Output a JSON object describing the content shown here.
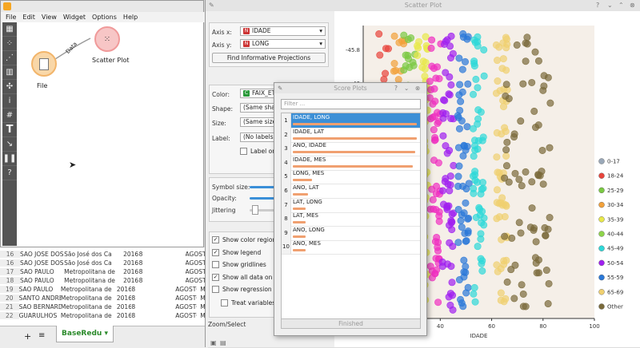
{
  "menu": [
    "File",
    "Edit",
    "View",
    "Widget",
    "Options",
    "Help"
  ],
  "workflow": {
    "file_label": "File",
    "scatter_label": "Scatter Plot",
    "link_label": "Data"
  },
  "sheet": {
    "rows": [
      [
        "16",
        "SAO JOSE DOS",
        "São José dos Ca",
        "2016",
        "8",
        "AGOSTO"
      ],
      [
        "16",
        "SAO JOSE DOS",
        "São José dos Ca",
        "2016",
        "8",
        "AGOSTO"
      ],
      [
        "17",
        "SAO PAULO",
        "Metropolitana de",
        "2016",
        "8",
        "AGOSTO"
      ],
      [
        "18",
        "SAO PAULO",
        "Metropolitana de",
        "2016",
        "8",
        "AGOSTO"
      ],
      [
        "19",
        "SAO PAULO",
        "Metropolitana de",
        "2016",
        "8",
        "AGOSTO"
      ],
      [
        "20",
        "SANTO ANDRE",
        "Metropolitana de",
        "2016",
        "8",
        "AGOSTO"
      ],
      [
        "21",
        "SAO BERNARD",
        "Metropolitana de",
        "2016",
        "8",
        "AGOSTO"
      ],
      [
        "22",
        "GUARULHOS",
        "Metropolitana de",
        "2016",
        "8",
        "AGOSTO"
      ]
    ],
    "extra_ma": "MA",
    "tab_label": "BaseRedu"
  },
  "scatter": {
    "title": "Scatter Plot",
    "axis_x_label": "Axis x:",
    "axis_x_value": "IDADE",
    "axis_y_label": "Axis y:",
    "axis_y_value": "LONG",
    "find_button": "Find Informative Projections",
    "color_label": "Color:",
    "color_value": "FAIX_ETAR",
    "shape_label": "Shape:",
    "shape_value": "(Same shape)",
    "size_label": "Size:",
    "size_value": "(Same size)",
    "label_label": "Label:",
    "label_value": "(No labels)",
    "label_only_selected": "Label only s",
    "symbol_size": "Symbol size:",
    "opacity": "Opacity:",
    "jittering": "Jittering",
    "checks": [
      {
        "label": "Show color regions",
        "checked": true
      },
      {
        "label": "Show legend",
        "checked": true
      },
      {
        "label": "Show gridlines",
        "checked": false
      },
      {
        "label": "Show all data on mou",
        "checked": true
      },
      {
        "label": "Show regression line",
        "checked": false
      }
    ],
    "treat_vars": "Treat variables as i",
    "zoom_select": "Zoom/Select"
  },
  "score": {
    "title": "Score Plots",
    "filter_placeholder": "Filter ...",
    "items": [
      {
        "n": "1",
        "label": "IDADE, LONG",
        "score": 0.98,
        "selected": true
      },
      {
        "n": "2",
        "label": "IDADE, LAT",
        "score": 0.98,
        "selected": false
      },
      {
        "n": "3",
        "label": "ANO, IDADE",
        "score": 0.97,
        "selected": false
      },
      {
        "n": "4",
        "label": "IDADE, MES",
        "score": 0.95,
        "selected": false
      },
      {
        "n": "5",
        "label": "LONG, MES",
        "score": 0.15,
        "selected": false
      },
      {
        "n": "6",
        "label": "ANO, LAT",
        "score": 0.12,
        "selected": false
      },
      {
        "n": "7",
        "label": "LAT, LONG",
        "score": 0.1,
        "selected": false
      },
      {
        "n": "8",
        "label": "LAT, MES",
        "score": 0.1,
        "selected": false
      },
      {
        "n": "9",
        "label": "ANO, LONG",
        "score": 0.1,
        "selected": false
      },
      {
        "n": "10",
        "label": "ANO, MES",
        "score": 0.1,
        "selected": false
      }
    ],
    "finished": "Finished"
  },
  "chart_data": {
    "type": "scatter",
    "xlabel": "IDADE",
    "ylabel": "",
    "x_ticks": [
      "40",
      "60",
      "80",
      "100"
    ],
    "y_ticks": [
      "-45.8",
      "-46"
    ],
    "legend": [
      {
        "label": "0-17",
        "color": "#9aa8b8"
      },
      {
        "label": "18-24",
        "color": "#e8453c"
      },
      {
        "label": "25-29",
        "color": "#7ac943"
      },
      {
        "label": "30-34",
        "color": "#f2a13a"
      },
      {
        "label": "35-39",
        "color": "#e8e84a"
      },
      {
        "label": "40-44",
        "color": "#8ed44a"
      },
      {
        "label": "45-49",
        "color": "#2ed8d8"
      },
      {
        "label": "50-54",
        "color": "#a020f0"
      },
      {
        "label": "55-59",
        "color": "#2a78d8"
      },
      {
        "label": "65-69",
        "color": "#f0d070"
      },
      {
        "label": "Other",
        "color": "#7a6a3a"
      }
    ],
    "bands": [
      {
        "x": 18,
        "color": "#e8453c"
      },
      {
        "x": 24,
        "color": "#f2a13a"
      },
      {
        "x": 28,
        "color": "#7ac943"
      },
      {
        "x": 33,
        "color": "#e8e84a"
      },
      {
        "x": 38,
        "color": "#f030c0"
      },
      {
        "x": 43,
        "color": "#a020f0"
      },
      {
        "x": 49,
        "color": "#2a78d8"
      },
      {
        "x": 55,
        "color": "#2ed8d8"
      },
      {
        "x": 64,
        "color": "#f0d070"
      },
      {
        "x": 74,
        "color": "#7a6a3a"
      }
    ]
  }
}
